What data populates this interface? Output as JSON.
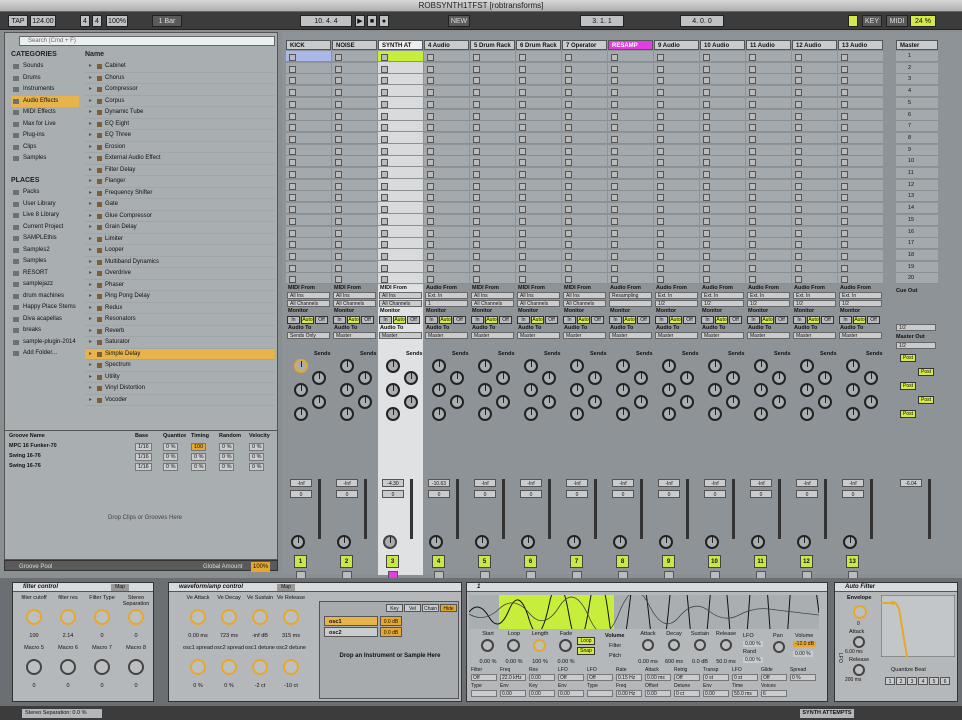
{
  "window": {
    "title": "ROBSYNTH1TFST  [robtransforms]"
  },
  "transport": {
    "tap": "TAP",
    "tempo": "124.00",
    "sig_num": "4",
    "sig_den": "4",
    "zoom": "100%",
    "quant": "1 Bar",
    "position": "10.   4.   4",
    "new": "NEW",
    "loop_start": "3.   1.   1",
    "loop_len": "4.   0.   0",
    "key": "KEY",
    "midi": "MIDI",
    "cpu": "24 %"
  },
  "browser": {
    "search_placeholder": "Search (Cmd + F)",
    "categories_header": "CATEGORIES",
    "name_header": "Name",
    "categories": [
      "Sounds",
      "Drums",
      "Instruments",
      "Audio Effects",
      "MIDI Effects",
      "Max for Live",
      "Plug-ins",
      "Clips",
      "Samples"
    ],
    "places_header": "PLACES",
    "places": [
      "Packs",
      "User Library",
      "Live 8 Library",
      "Current Project",
      "SAMPLEthis",
      "Samples2",
      "Samples",
      "RESORT",
      "samplejazz",
      "drum machines",
      "Happy Place Stems",
      "Diva acapellas",
      "breaks",
      "sample-plugin-2014",
      "Add Folder..."
    ],
    "items": [
      "Cabinet",
      "Chorus",
      "Compressor",
      "Corpus",
      "Dynamic Tube",
      "EQ Eight",
      "EQ Three",
      "Erosion",
      "External Audio Effect",
      "Filter Delay",
      "Flanger",
      "Frequency Shifter",
      "Gate",
      "Glue Compressor",
      "Grain Delay",
      "Limiter",
      "Looper",
      "Multiband Dynamics",
      "Overdrive",
      "Phaser",
      "Ping Pong Delay",
      "Redux",
      "Resonators",
      "Reverb",
      "Saturator",
      "Simple Delay",
      "Spectrum",
      "Utility",
      "Vinyl Distortion",
      "Vocoder"
    ]
  },
  "groove": {
    "headers": [
      "Groove Name",
      "Base",
      "Quantize",
      "Timing",
      "Random",
      "Velocity"
    ],
    "rows": [
      [
        "MPC 16 Funker-70",
        "1/16",
        "0 %",
        "100",
        "0 %",
        "0 %"
      ],
      [
        "Swing 16-76",
        "1/16",
        "0 %",
        "0 %",
        "0 %",
        "0 %"
      ],
      [
        "Swing 16-76",
        "1/16",
        "0 %",
        "0 %",
        "0 %",
        "0 %"
      ]
    ],
    "drop_text": "Drop Clips or Grooves Here",
    "pool_label": "Groove Pool",
    "global_amount_label": "Global Amount",
    "global_amount": "100%"
  },
  "tracks": [
    {
      "name": "KICK",
      "from": "MIDI From",
      "in": "All Ins",
      "ch": "All Channels",
      "to": "Sends Only",
      "num": "1",
      "vol": "-Inf",
      "pan": "0"
    },
    {
      "name": "NOISE",
      "from": "MIDI From",
      "in": "All Ins",
      "ch": "All Channels",
      "to": "Master",
      "num": "2",
      "vol": "-Inf",
      "pan": "0"
    },
    {
      "name": "SYNTH AT",
      "from": "MIDI From",
      "in": "All Ins",
      "ch": "All Channels",
      "to": "Master",
      "num": "3",
      "vol": "-4.30",
      "pan": "0"
    },
    {
      "name": "4 Audio",
      "from": "Audio From",
      "in": "Ext. In",
      "ch": "1",
      "to": "Master",
      "num": "4",
      "vol": "-10.63",
      "pan": "0"
    },
    {
      "name": "5 Drum Rack",
      "from": "MIDI From",
      "in": "All Ins",
      "ch": "All Channels",
      "to": "Master",
      "num": "5",
      "vol": "-Inf",
      "pan": "0"
    },
    {
      "name": "6 Drum Rack",
      "from": "MIDI From",
      "in": "All Ins",
      "ch": "All Channels",
      "to": "Master",
      "num": "6",
      "vol": "-Inf",
      "pan": "0"
    },
    {
      "name": "7 Operator",
      "from": "MIDI From",
      "in": "All Ins",
      "ch": "All Channels",
      "to": "Master",
      "num": "7",
      "vol": "-Inf",
      "pan": "0"
    },
    {
      "name": "RESAMP",
      "from": "Audio From",
      "in": "Resampling",
      "ch": "",
      "to": "Master",
      "num": "8",
      "vol": "-Inf",
      "pan": "0"
    },
    {
      "name": "9 Audio",
      "from": "Audio From",
      "in": "Ext. In",
      "ch": "1/2",
      "to": "Master",
      "num": "9",
      "vol": "-Inf",
      "pan": "0"
    },
    {
      "name": "10 Audio",
      "from": "Audio From",
      "in": "Ext. In",
      "ch": "1/2",
      "to": "Master",
      "num": "10",
      "vol": "-Inf",
      "pan": "0"
    },
    {
      "name": "11 Audio",
      "from": "Audio From",
      "in": "Ext. In",
      "ch": "1/2",
      "to": "Master",
      "num": "11",
      "vol": "-Inf",
      "pan": "0"
    },
    {
      "name": "12 Audio",
      "from": "Audio From",
      "in": "Ext. In",
      "ch": "1/2",
      "to": "Master",
      "num": "12",
      "vol": "-Inf",
      "pan": "0"
    },
    {
      "name": "13 Audio",
      "from": "Audio From",
      "in": "Ext. In",
      "ch": "1/2",
      "to": "Master",
      "num": "13",
      "vol": "-Inf",
      "pan": "0"
    }
  ],
  "master": {
    "name": "Master",
    "scenes": [
      "1",
      "2",
      "3",
      "4",
      "5",
      "6",
      "7",
      "8",
      "9",
      "10",
      "11",
      "12",
      "13",
      "14",
      "15",
      "16",
      "17",
      "18",
      "19",
      "20"
    ],
    "cue_out": "Cue Out",
    "cue_val": "1/2",
    "master_out": "Master Out",
    "master_val": "1/2",
    "vol": "-6.04"
  },
  "mixer_labels": {
    "monitor": "Monitor",
    "in": "In",
    "auto": "Auto",
    "off": "Off",
    "audio_to": "Audio To",
    "sends": "Sends",
    "post": "Post"
  },
  "devices": {
    "filter": {
      "title": "filter control",
      "map": "Map",
      "macros": [
        [
          "filter cutoff",
          "100"
        ],
        [
          "filter res",
          "2.14"
        ],
        [
          "Filter Type",
          "0"
        ],
        [
          "Stereo Separation",
          "0"
        ],
        [
          "Macro 5",
          "0"
        ],
        [
          "Macro 6",
          "0"
        ],
        [
          "Macro 7",
          "0"
        ],
        [
          "Macro 8",
          "0"
        ]
      ]
    },
    "waveform": {
      "title": "waveform/amp control",
      "map": "Map",
      "macros": [
        [
          "Ve Attack",
          "0.00 ms"
        ],
        [
          "Ve Decay",
          "723 ms"
        ],
        [
          "Ve Sustain",
          "-inf dB"
        ],
        [
          "Ve Release",
          "315 ms"
        ],
        [
          "osc1 spread",
          "0 %"
        ],
        [
          "osc2 spread",
          "0 %"
        ],
        [
          "osc1 detune",
          "-2 ct"
        ],
        [
          "osc2 detune",
          "-10 ct"
        ]
      ],
      "chains": [
        "osc1",
        "osc2"
      ],
      "tabs": [
        "Key",
        "Vel",
        "Chain",
        "Hide"
      ],
      "drop": "Drop an Instrument or Sample Here",
      "chain_vol": "0.0 dB"
    },
    "sampler": {
      "title": "1",
      "params": [
        "Start",
        "Loop",
        "Length",
        "Fade"
      ],
      "vals": [
        "0.00 %",
        "0.00 %",
        "100 %",
        "0.00 %"
      ],
      "loop": "Loop",
      "snap": "Snap",
      "vol_label": "Volume",
      "filter": "Filter",
      "pitch": "Pitch",
      "env": [
        "Attack",
        "Decay",
        "Sustain",
        "Release"
      ],
      "env_vals": [
        "0.00 ms",
        "600 ms",
        "0.0 dB",
        "50.0 ms"
      ],
      "lfo": "LFO",
      "pan": "Pan",
      "rand": "Rand",
      "lfo_vals": [
        "0.00 %",
        "0.00 %"
      ],
      "volume_val": "-12.0 dB",
      "vol_val2": "0.00 %",
      "row2": [
        "Filter",
        "Freq",
        "Res",
        "LFO",
        "LFO",
        "Rate",
        "Attack",
        "Retrig",
        "Transp",
        "LFO",
        "Glide",
        "Spread"
      ],
      "row2_vals": [
        "Off",
        "22.0 kHz",
        "0.00",
        "Off",
        "Off",
        "0.15 Hz",
        "0.00 ms",
        "Off",
        "0 st",
        "0 st",
        "Off",
        "0 %"
      ],
      "row3": [
        "Type",
        "Env",
        "Key",
        "Env",
        "Type",
        "Freq",
        "Offset",
        "Detune",
        "Env",
        "Time",
        "Voices"
      ],
      "row3_vals": [
        "",
        "0.00",
        "0.00",
        "0.00",
        "",
        "0.00 Hz",
        "0.00",
        "0 ct",
        "0.00",
        "50.0 ms",
        "6"
      ]
    },
    "autofilter": {
      "title": "Auto Filter",
      "envelope": "Envelope",
      "attack": "Attack",
      "attack_val": "6.00 ms",
      "release": "Release",
      "release_val": "200 ms",
      "quantize": "Quantize Beat",
      "beats": [
        "1",
        "2",
        "3",
        "4",
        "5",
        "6"
      ],
      "lfo": "LFO",
      "val0": "0"
    }
  },
  "status": {
    "text": "Stereo Separation: 0.0 %",
    "track": "SYNTH ATTEMPTS"
  }
}
